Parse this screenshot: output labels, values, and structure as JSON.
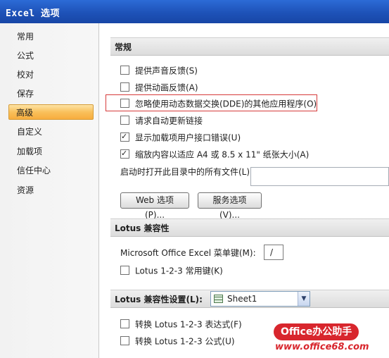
{
  "window": {
    "title": "Excel 选项"
  },
  "sidebar": {
    "items": [
      {
        "label": "常用"
      },
      {
        "label": "公式"
      },
      {
        "label": "校对"
      },
      {
        "label": "保存"
      },
      {
        "label": "高级",
        "active": true
      },
      {
        "label": "自定义"
      },
      {
        "label": "加载项"
      },
      {
        "label": "信任中心"
      },
      {
        "label": "资源"
      }
    ]
  },
  "general": {
    "header": "常规",
    "options": [
      {
        "label": "提供声音反馈(S)",
        "checked": false
      },
      {
        "label": "提供动画反馈(A)",
        "checked": false
      },
      {
        "label": "忽略使用动态数据交换(DDE)的其他应用程序(O)",
        "checked": false,
        "highlighted": true
      },
      {
        "label": "请求自动更新链接",
        "checked": false
      },
      {
        "label": "显示加载项用户接口错误(U)",
        "checked": true
      },
      {
        "label": "缩放内容以适应 A4 或 8.5 x 11\" 纸张大小(A)",
        "checked": true
      }
    ],
    "startup_label": "启动时打开此目录中的所有文件(L):",
    "startup_value": "",
    "web_options_button": "Web 选项(P)...",
    "service_options_button": "服务选项(V)..."
  },
  "lotus_compat": {
    "header": "Lotus 兼容性",
    "menu_key_label": "Microsoft Office Excel 菜单键(M):",
    "menu_key_value": "/",
    "nav_keys_label": "Lotus 1-2-3 常用键(K)",
    "nav_keys_checked": false
  },
  "lotus_settings": {
    "header": "Lotus 兼容性设置(L):",
    "sheet_select": "Sheet1",
    "options": [
      {
        "label": "转换 Lotus 1-2-3 表达式(F)",
        "checked": false
      },
      {
        "label": "转换 Lotus 1-2-3 公式(U)",
        "checked": false
      }
    ]
  },
  "watermark": {
    "logo": "Office办公助手",
    "url": "www.office68.com"
  },
  "colors": {
    "accent": "#f9c05b",
    "titlebar": "#1e52b8",
    "highlight": "#d63a3a",
    "watermark": "#d8262d"
  },
  "icons": {
    "sheet": "sheet-icon",
    "dropdown": "chevron-down-icon",
    "check": "check-icon"
  }
}
